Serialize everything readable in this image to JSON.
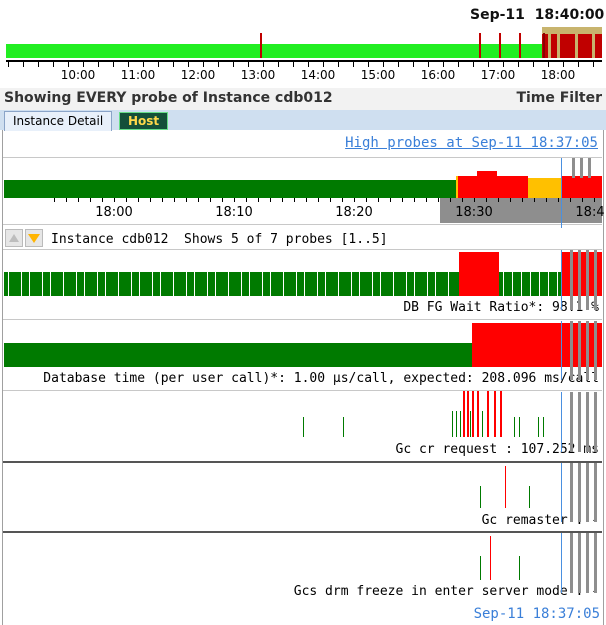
{
  "overview": {
    "date": "Sep-11",
    "time": "18:40:00",
    "hour_labels": [
      "10:00",
      "11:00",
      "12:00",
      "13:00",
      "14:00",
      "15:00",
      "16:00",
      "17:00",
      "18:00"
    ]
  },
  "status": {
    "left": "Showing EVERY probe of Instance cdb012",
    "right": "Time Filter"
  },
  "tabs": [
    {
      "label": "Instance Detail",
      "active": true
    },
    {
      "label": "Host",
      "active": false
    }
  ],
  "detail": {
    "high_probes_link": "High probes at Sep-11 18:37:05",
    "time_labels": [
      "18:00",
      "18:10",
      "18:20",
      "18:30",
      "18:4"
    ]
  },
  "probe_header": {
    "up_icon": "arrow-up-icon",
    "down_icon": "arrow-down-icon",
    "title": "Instance cdb012  Shows 5 of 7 probes [1..5]"
  },
  "probes": [
    {
      "caption": "DB FG Wait Ratio*: 98.1 %"
    },
    {
      "caption": "Database time (per user call)*: 1.00 µs/call, expected: 208.096 ms/call"
    },
    {
      "caption": "Gc cr request : 107.252 ms"
    },
    {
      "caption": "Gc remaster : -"
    },
    {
      "caption": "Gcs drm freeze in enter server mode : -"
    }
  ],
  "footer": {
    "clock": "Sep-11 18:37:05"
  },
  "colors": {
    "ok": "#007a00",
    "bright_ok": "#22ee22",
    "alert": "#ff0000",
    "dark_alert": "#c00000",
    "warn": "#ffc000",
    "link": "#3a7fd8",
    "tab_bg": "#cfdff0"
  }
}
